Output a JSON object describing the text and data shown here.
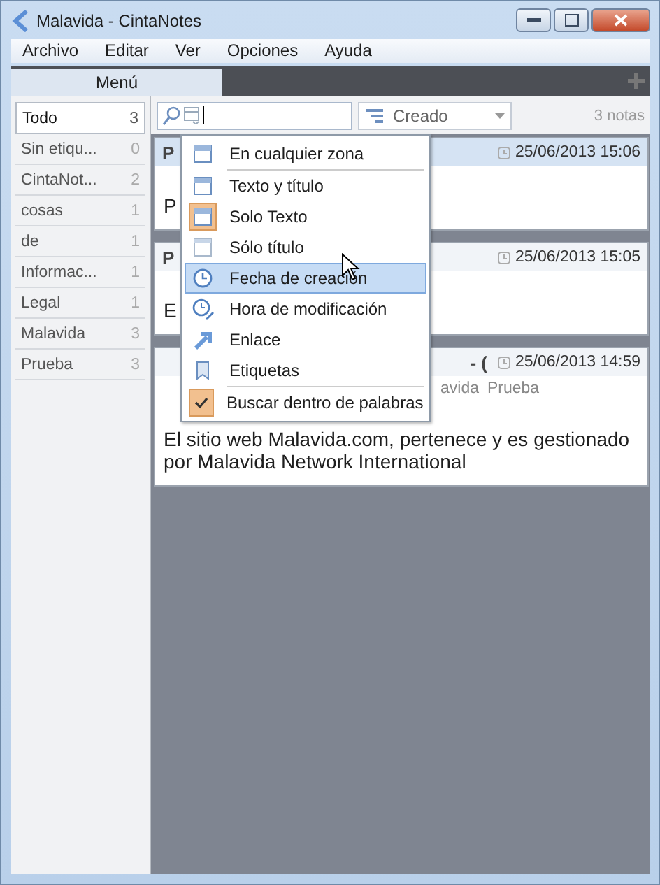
{
  "window": {
    "title": "Malavida - CintaNotes"
  },
  "menu_bar": [
    "Archivo",
    "Editar",
    "Ver",
    "Opciones",
    "Ayuda"
  ],
  "tabs": [
    {
      "label": "Menú",
      "selected": true
    }
  ],
  "sidebar": {
    "items": [
      {
        "label": "Todo",
        "count": "3",
        "selected": true
      },
      {
        "label": "Sin etiqu...",
        "count": "0",
        "selected": false
      },
      {
        "label": "CintaNot...",
        "count": "2",
        "selected": false
      },
      {
        "label": "cosas",
        "count": "1",
        "selected": false
      },
      {
        "label": "de",
        "count": "1",
        "selected": false
      },
      {
        "label": "Informac...",
        "count": "1",
        "selected": false
      },
      {
        "label": "Legal",
        "count": "1",
        "selected": false
      },
      {
        "label": "Malavida",
        "count": "3",
        "selected": false
      },
      {
        "label": "Prueba",
        "count": "3",
        "selected": false
      }
    ]
  },
  "toolbar": {
    "sort": "Creado",
    "note_count": "3 notas"
  },
  "notes": [
    {
      "kind": "plain",
      "title": "P",
      "date": "25/06/2013 15:06",
      "body": "P",
      "selected": true
    },
    {
      "kind": "plain",
      "title": "P",
      "date": "25/06/2013 15:05",
      "body": "E",
      "selected": false
    },
    {
      "kind": "link",
      "title": "- (",
      "date": "25/06/2013 14:59",
      "tags": [
        "avida",
        "Prueba"
      ],
      "body": "El sitio web Malavida.com, pertenece y es gestionado por Malavida Network International",
      "selected": false
    }
  ],
  "search_menu": [
    {
      "kind": "zone",
      "label": "En cualquier zona",
      "checked": false,
      "selected": false
    },
    {
      "kind": "separator"
    },
    {
      "kind": "zone",
      "label": "Texto y título",
      "checked": false,
      "selected": false
    },
    {
      "kind": "zone",
      "label": "Solo Texto",
      "checked": true,
      "selected": false
    },
    {
      "kind": "title",
      "label": "Sólo título",
      "checked": false,
      "selected": false
    },
    {
      "kind": "clock",
      "label": "Fecha de creación",
      "checked": false,
      "selected": true
    },
    {
      "kind": "clock-edit",
      "label": "Hora de modificación",
      "checked": false,
      "selected": false
    },
    {
      "kind": "link",
      "label": "Enlace",
      "checked": false,
      "selected": false
    },
    {
      "kind": "tag",
      "label": "Etiquetas",
      "checked": false,
      "selected": false
    },
    {
      "kind": "separator"
    },
    {
      "kind": "check",
      "label": "Buscar dentro de palabras",
      "checked": true,
      "selected": false
    }
  ]
}
